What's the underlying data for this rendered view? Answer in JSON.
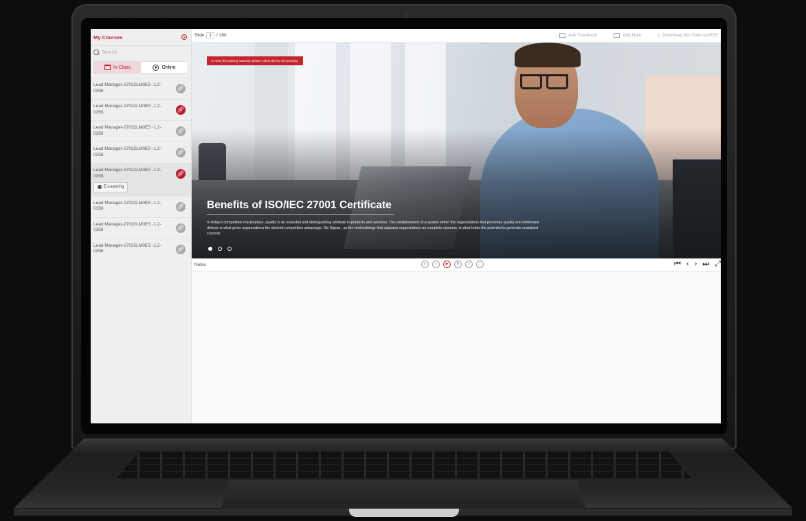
{
  "sidebar": {
    "title": "My Courses",
    "search_placeholder": "Search",
    "tabs": [
      {
        "label": "In Class",
        "active": true
      },
      {
        "label": "Online",
        "active": false
      }
    ],
    "courses": [
      {
        "title": "Lead Manager-27032LM0ES -1.2-0356",
        "link_color": "gray"
      },
      {
        "title": "Lead Manager-27032LM0ES -1.2-0356",
        "link_color": "red"
      },
      {
        "title": "Lead Manager-27032LM0ES -1.2-0356",
        "link_color": "gray"
      },
      {
        "title": "Lead Manager-27032LM0ES -1.2-0356",
        "link_color": "gray"
      },
      {
        "title": "Lead Manager-27032LM0ES -1.2-0356",
        "link_color": "red",
        "tag": "E-Learning"
      },
      {
        "title": "Lead Manager-27032LM0ES -1.2-0356",
        "link_color": "gray"
      },
      {
        "title": "Lead Manager-27032LM0ES -1.2-0356",
        "link_color": "gray"
      },
      {
        "title": "Lead Manager-27032LM0ES -1.2-0356",
        "link_color": "gray"
      }
    ]
  },
  "topbar": {
    "slide_label": "Slide",
    "slide_current": "1",
    "slide_total": "/ 160",
    "add_feedback": "Add Feedback",
    "add_note": "Add Note",
    "download": "Download this Slide on PDF"
  },
  "hero": {
    "notice": "To view the training material, please select the list of course(s).",
    "title": "Benefits of ISO/IEC 27001 Certificate",
    "description": "In today's competitive marketplace, quality is an essential and distinguishing attribute in products and services. The establishment of a system within the organizations that promotes quality and eliminates defects is what gives organizations the desired competitive advantage. Six Sigma , as the methodology that captures organizations as complete systems, is what holds the potential to generate sustained success.",
    "active_dot": 0
  },
  "notes": {
    "label": "Notes"
  },
  "colors": {
    "accent": "#b71c2b",
    "notice_bg": "#c4262f"
  }
}
